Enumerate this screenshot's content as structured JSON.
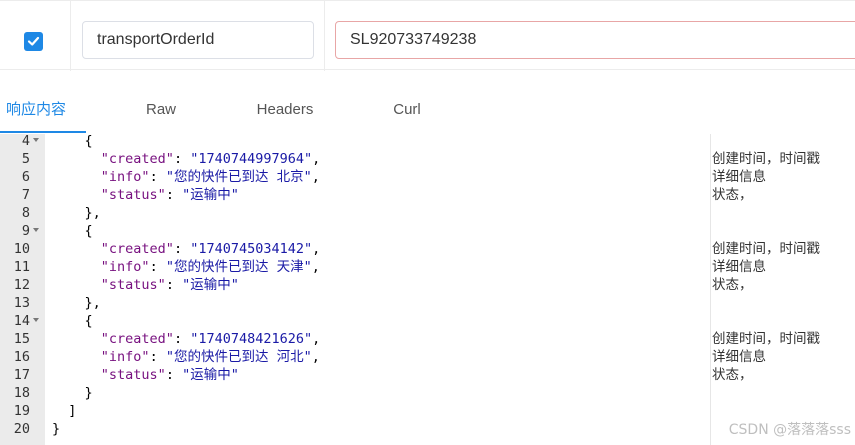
{
  "param": {
    "checked": true,
    "key": "transportOrderId",
    "value": "SL920733749238"
  },
  "tabs": [
    {
      "label": "响应内容",
      "active": true
    },
    {
      "label": "Raw",
      "active": false
    },
    {
      "label": "Headers",
      "active": false
    },
    {
      "label": "Curl",
      "active": false
    }
  ],
  "editor": {
    "lines": [
      {
        "n": "4",
        "fold": true,
        "tokens": [
          [
            "p",
            "    {"
          ]
        ]
      },
      {
        "n": "5",
        "tokens": [
          [
            "p",
            "      "
          ],
          [
            "k",
            "\"created\""
          ],
          [
            "p",
            ": "
          ],
          [
            "s",
            "\"1740744997964\""
          ],
          [
            "p",
            ","
          ]
        ],
        "comment": "创建时间，时间戳"
      },
      {
        "n": "6",
        "tokens": [
          [
            "p",
            "      "
          ],
          [
            "k",
            "\"info\""
          ],
          [
            "p",
            ": "
          ],
          [
            "s",
            "\"您的快件已到达 北京\""
          ],
          [
            "p",
            ","
          ]
        ],
        "comment": "详细信息"
      },
      {
        "n": "7",
        "tokens": [
          [
            "p",
            "      "
          ],
          [
            "k",
            "\"status\""
          ],
          [
            "p",
            ": "
          ],
          [
            "s",
            "\"运输中\""
          ]
        ],
        "comment": "状态，"
      },
      {
        "n": "8",
        "tokens": [
          [
            "p",
            "    },"
          ]
        ]
      },
      {
        "n": "9",
        "fold": true,
        "tokens": [
          [
            "p",
            "    {"
          ]
        ]
      },
      {
        "n": "10",
        "tokens": [
          [
            "p",
            "      "
          ],
          [
            "k",
            "\"created\""
          ],
          [
            "p",
            ": "
          ],
          [
            "s",
            "\"1740745034142\""
          ],
          [
            "p",
            ","
          ]
        ],
        "comment": "创建时间，时间戳"
      },
      {
        "n": "11",
        "tokens": [
          [
            "p",
            "      "
          ],
          [
            "k",
            "\"info\""
          ],
          [
            "p",
            ": "
          ],
          [
            "s",
            "\"您的快件已到达 天津\""
          ],
          [
            "p",
            ","
          ]
        ],
        "comment": "详细信息"
      },
      {
        "n": "12",
        "tokens": [
          [
            "p",
            "      "
          ],
          [
            "k",
            "\"status\""
          ],
          [
            "p",
            ": "
          ],
          [
            "s",
            "\"运输中\""
          ]
        ],
        "comment": "状态，"
      },
      {
        "n": "13",
        "tokens": [
          [
            "p",
            "    },"
          ]
        ]
      },
      {
        "n": "14",
        "fold": true,
        "tokens": [
          [
            "p",
            "    {"
          ]
        ]
      },
      {
        "n": "15",
        "tokens": [
          [
            "p",
            "      "
          ],
          [
            "k",
            "\"created\""
          ],
          [
            "p",
            ": "
          ],
          [
            "s",
            "\"1740748421626\""
          ],
          [
            "p",
            ","
          ]
        ],
        "comment": "创建时间，时间戳"
      },
      {
        "n": "16",
        "tokens": [
          [
            "p",
            "      "
          ],
          [
            "k",
            "\"info\""
          ],
          [
            "p",
            ": "
          ],
          [
            "s",
            "\"您的快件已到达 河北\""
          ],
          [
            "p",
            ","
          ]
        ],
        "comment": "详细信息"
      },
      {
        "n": "17",
        "tokens": [
          [
            "p",
            "      "
          ],
          [
            "k",
            "\"status\""
          ],
          [
            "p",
            ": "
          ],
          [
            "s",
            "\"运输中\""
          ]
        ],
        "comment": "状态，"
      },
      {
        "n": "18",
        "tokens": [
          [
            "p",
            "    }"
          ]
        ]
      },
      {
        "n": "19",
        "tokens": [
          [
            "p",
            "  ]"
          ]
        ]
      },
      {
        "n": "20",
        "tokens": [
          [
            "p",
            "}"
          ]
        ]
      }
    ]
  },
  "watermark": "CSDN @落落落sss",
  "colors": {
    "accent": "#1e88e5",
    "json_key": "#77107f",
    "json_string": "#1a1aa6"
  }
}
